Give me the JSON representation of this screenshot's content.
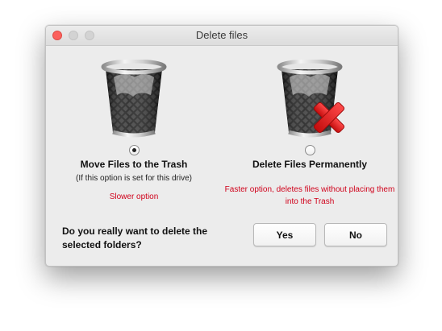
{
  "window": {
    "title": "Delete files"
  },
  "options": [
    {
      "title": "Move Files to the Trash",
      "subtitle": "(If this option is set for this drive)",
      "note": "Slower option",
      "selected": true,
      "icon": "trash-bin-icon"
    },
    {
      "title": "Delete Files Permanently",
      "subtitle": "",
      "note": "Faster option, deletes files without placing them into the Trash",
      "selected": false,
      "icon": "trash-bin-delete-icon"
    }
  ],
  "prompt": {
    "question": "Do you really want to delete the selected folders?"
  },
  "buttons": {
    "yes_label": "Yes",
    "no_label": "No"
  },
  "colors": {
    "note_text": "#d0021b",
    "close_button": "#fc605c",
    "delete_mark": "#e01e1e"
  }
}
